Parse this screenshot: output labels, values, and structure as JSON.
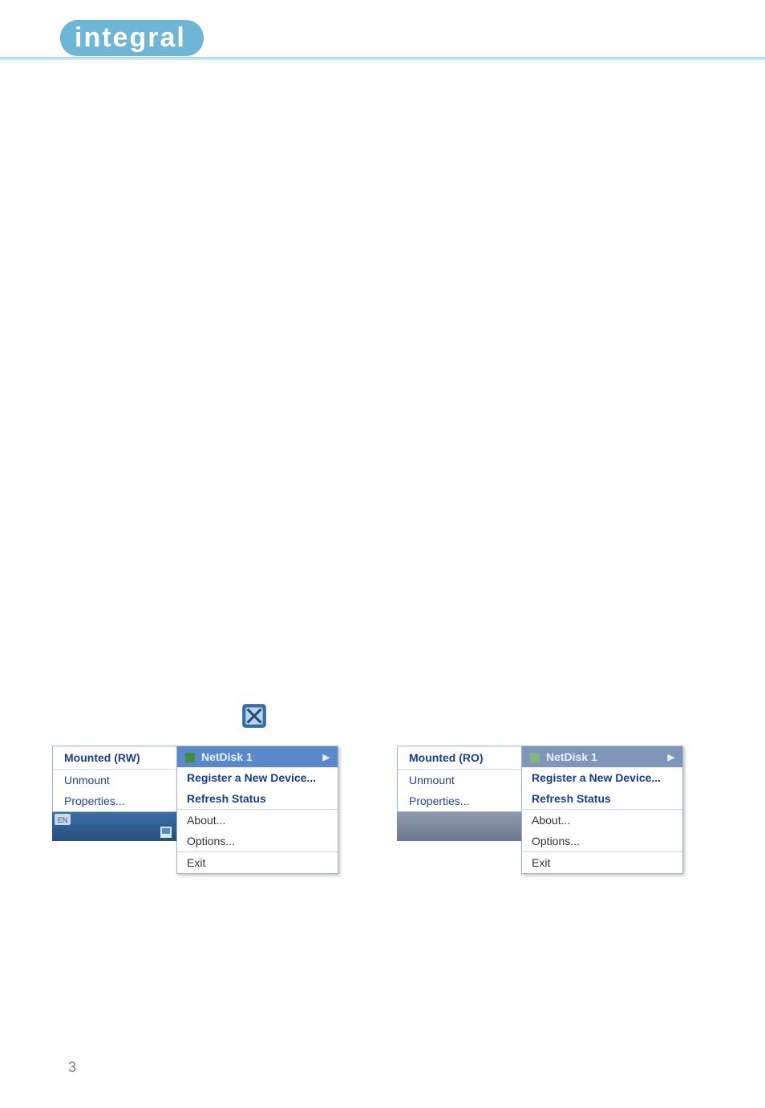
{
  "header": {
    "brand": "integral"
  },
  "menus": {
    "common": {
      "register": "Register a New Device...",
      "refresh": "Refresh Status",
      "about": "About...",
      "options": "Options...",
      "exit": "Exit"
    },
    "rw": {
      "status": "Mounted (RW)",
      "device": "NetDisk 1",
      "items": [
        "Unmount",
        "Properties..."
      ]
    },
    "ro": {
      "status": "Mounted (RO)",
      "device": "NetDisk 1",
      "items": [
        "Unmount",
        "Properties..."
      ]
    }
  },
  "footer": {
    "page": "3"
  }
}
